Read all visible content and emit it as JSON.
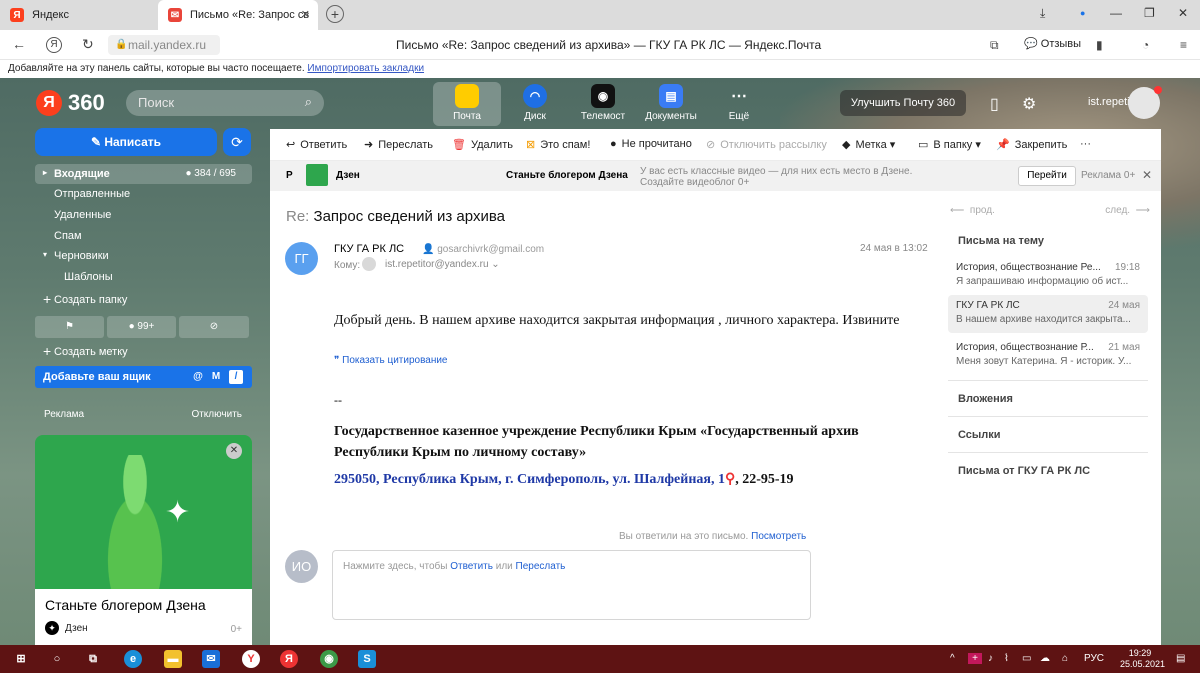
{
  "browser": {
    "tabs": [
      {
        "label": "Яндекс"
      },
      {
        "label": "Письмо «Re: Запрос св"
      }
    ],
    "url": "mail.yandex.ru",
    "title": "Письмо «Re: Запрос сведений из архива» — ГКУ ГА РК ЛС — Яндекс.Почта",
    "reviews": "Отзывы",
    "bookmarks_hint": "Добавляйте на эту панель сайты, которые вы часто посещаете.",
    "bookmarks_link": "Импортировать закладки"
  },
  "header": {
    "logo_ya": "Я",
    "logo_360": "360",
    "search_placeholder": "Поиск",
    "services": [
      {
        "label": "Почта",
        "color": "#ffcc00"
      },
      {
        "label": "Диск",
        "color": "#1f6fe5"
      },
      {
        "label": "Телемост",
        "color": "#111111"
      },
      {
        "label": "Документы",
        "color": "#3a7cf5"
      },
      {
        "label": "Ещё",
        "color": "transparent"
      }
    ],
    "upgrade": "Улучшить Почту 360",
    "username": "ist.repetitor"
  },
  "sidebar": {
    "compose": "Написать",
    "folders": [
      {
        "label": "Входящие",
        "count": "384 / 695"
      },
      {
        "label": "Отправленные"
      },
      {
        "label": "Удаленные"
      },
      {
        "label": "Спам"
      },
      {
        "label": "Черновики"
      },
      {
        "label": "Шаблоны"
      }
    ],
    "create_folder": "Создать папку",
    "unread_count": "99+",
    "create_label": "Создать метку",
    "add_mailbox": "Добавьте ваш ящик",
    "ads_label": "Реклама",
    "ads_off": "Отключить",
    "ad_title": "Станьте блогером Дзена",
    "ad_source": "Дзен",
    "ad_age": "0+"
  },
  "toolbar": {
    "reply": "Ответить",
    "forward": "Переслать",
    "delete": "Удалить",
    "spam": "Это спам!",
    "unread": "Не прочитано",
    "unsubscribe": "Отключить рассылку",
    "label": "Метка",
    "move": "В папку",
    "pin": "Закрепить",
    "more": "···"
  },
  "promo": {
    "ad_mark": "Р",
    "name": "Дзен",
    "headline": "Станьте блогером Дзена",
    "text": "У вас есть классные видео — для них есть место в Дзене. Создайте видеоблог 0+",
    "button": "Перейти",
    "adv": "Реклама 0+"
  },
  "message": {
    "subject_prefix": "Re:",
    "subject": "Запрос сведений из архива",
    "sender_initials": "ГГ",
    "sender_name": "ГКУ ГА РК ЛС",
    "sender_email": "gosarchivrk@gmail.com",
    "date": "24 мая в 13:02",
    "to_label": "Кому:",
    "to_email": "ist.repetitor@yandex.ru",
    "body": "Добрый день. В нашем архиве находится закрытая информация , личного характера. Извините",
    "show_quote": "Показать цитирование",
    "sig_dash": "--",
    "sig_org": "Государственное казенное учреждение Республики Крым «Государственный архив Республики Крым по личному составу»",
    "sig_addr": "295050, Республика Крым, г. Симферополь, ул. Шалфейная, 1",
    "sig_phone": ", 22-95-19",
    "replied_text": "Вы ответили на это письмо.",
    "replied_link": "Посмотреть",
    "reply_initials": "ИО",
    "reply_hint": "Нажмите здесь, чтобы",
    "reply_link1": "Ответить",
    "reply_or": "или",
    "reply_link2": "Переслать"
  },
  "rightpane": {
    "prev": "прод.",
    "next": "след.",
    "thread_title": "Письма на тему",
    "threads": [
      {
        "from": "История, обществознание Ре...",
        "date": "19:18",
        "snippet": "Я запрашиваю информацию об ист..."
      },
      {
        "from": "ГКУ ГА РК ЛС",
        "date": "24 мая",
        "snippet": "В нашем архиве находится закрыта..."
      },
      {
        "from": "История, обществознание Р...",
        "date": "21 мая",
        "snippet": "Меня зовут Катерина. Я - историк. У..."
      }
    ],
    "attachments": "Вложения",
    "links": "Ссылки",
    "from_sender": "Письма от ГКУ ГА РК ЛС"
  },
  "taskbar": {
    "lang": "РУС",
    "time": "19:29",
    "date": "25.05.2021"
  }
}
